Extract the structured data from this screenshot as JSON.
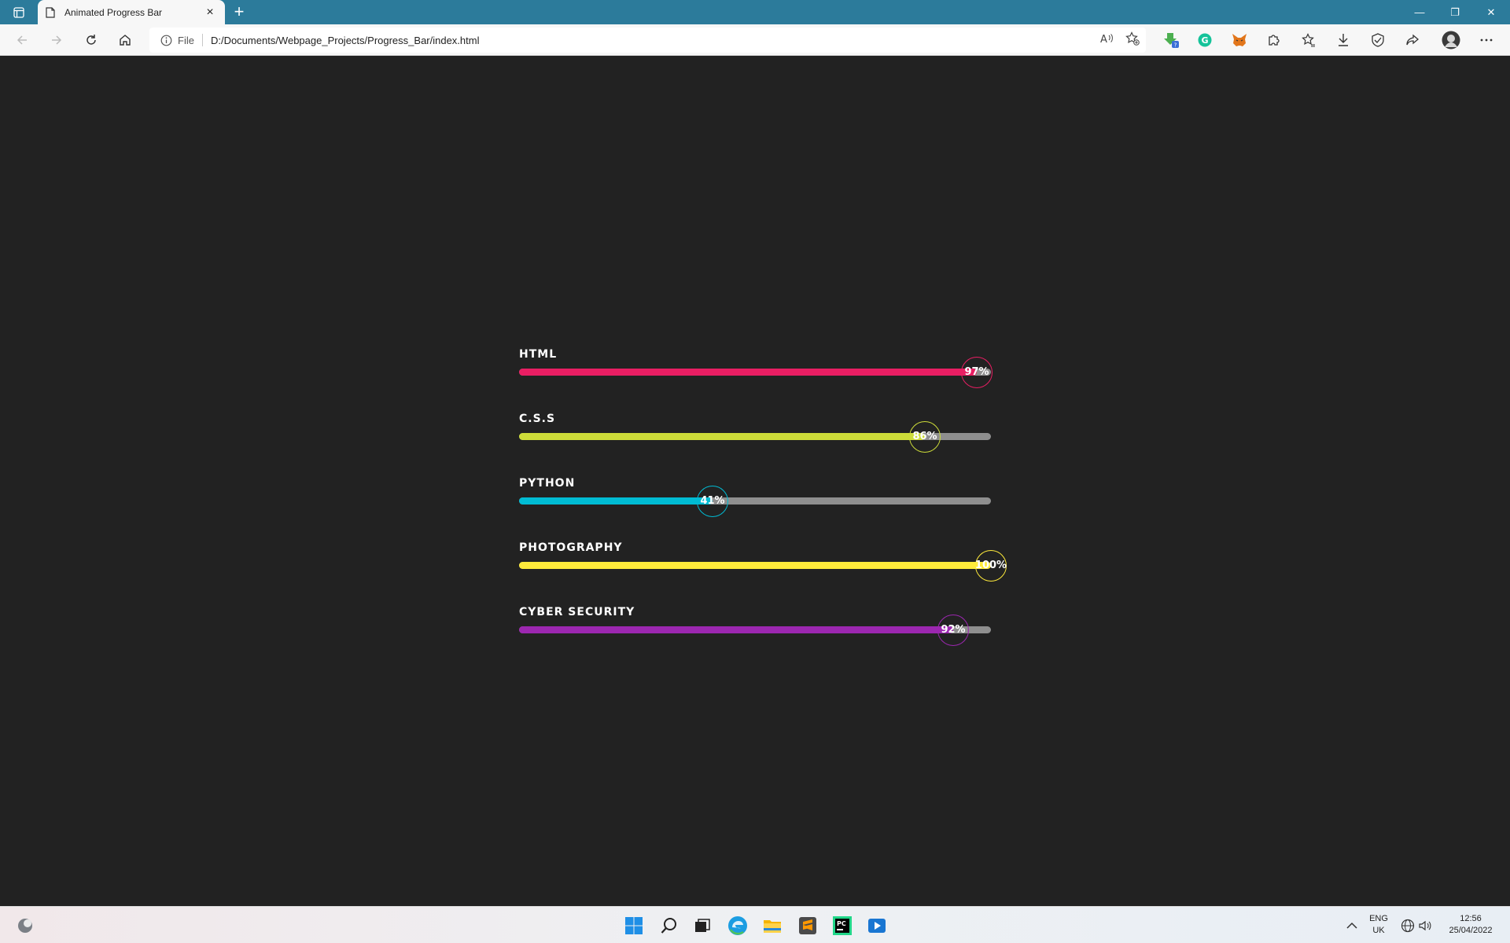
{
  "browser": {
    "tab_title": "Animated Progress Bar",
    "tab_close": "×",
    "new_tab": "+",
    "window_controls": {
      "minimize": "—",
      "restore": "❐",
      "close": "✕"
    },
    "address": {
      "scheme_label": "File",
      "url": "D:/Documents/Webpage_Projects/Progress_Bar/index.html"
    },
    "toolbar_icons": [
      "back-icon",
      "forward-icon",
      "refresh-icon",
      "home-icon",
      "read-aloud-icon",
      "add-favorite-icon",
      "extension-download-icon",
      "grammarly-icon",
      "metamask-icon",
      "extensions-icon",
      "favorites-icon",
      "downloads-icon",
      "browser-essentials-icon",
      "share-icon",
      "profile-avatar",
      "more-menu-icon"
    ]
  },
  "skills": [
    {
      "label": "HTML",
      "percent": 97,
      "percent_text": "97%",
      "color": "#e91e63"
    },
    {
      "label": "C.S.S",
      "percent": 86,
      "percent_text": "86%",
      "color": "#cddc39"
    },
    {
      "label": "PYTHON",
      "percent": 41,
      "percent_text": "41%",
      "color": "#00bcd4"
    },
    {
      "label": "PHOTOGRAPHY",
      "percent": 100,
      "percent_text": "100%",
      "color": "#ffeb3b"
    },
    {
      "label": "CYBER  SECURITY",
      "percent": 92,
      "percent_text": "92%",
      "color": "#9c27b0"
    }
  ],
  "track_color": "#8f8f8f",
  "taskbar": {
    "language": "ENG",
    "region": "UK",
    "time": "12:56",
    "date": "25/04/2022",
    "pinned": [
      "start-icon",
      "search-icon",
      "task-view-icon",
      "edge-icon",
      "file-explorer-icon",
      "sublime-text-icon",
      "pycharm-icon",
      "media-player-icon"
    ]
  }
}
